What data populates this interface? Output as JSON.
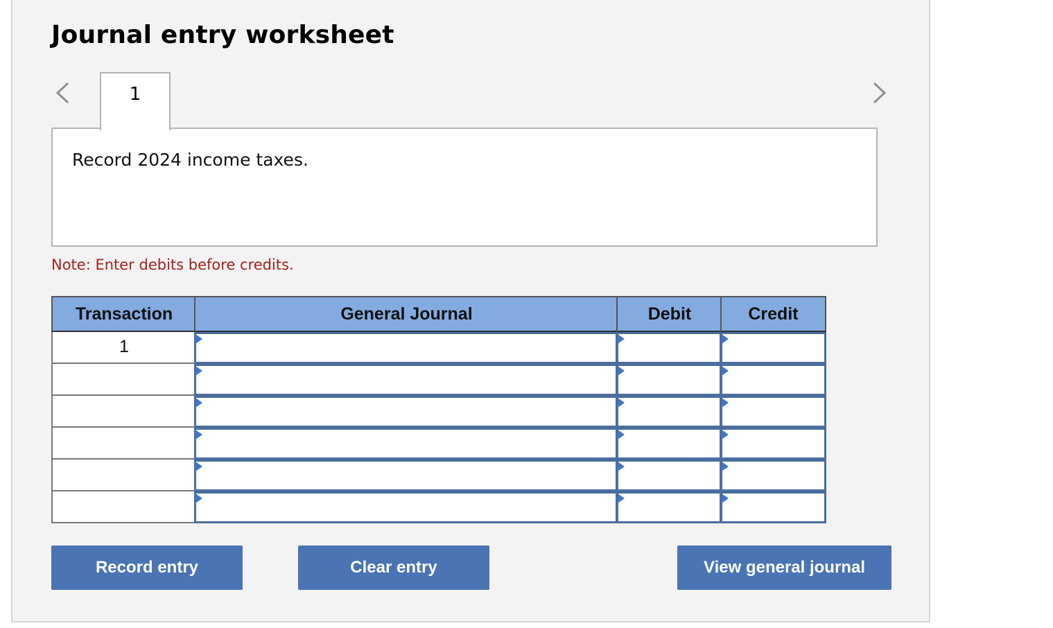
{
  "worksheet": {
    "title": "Journal entry worksheet",
    "tabs": [
      {
        "label": "1"
      }
    ],
    "description": "Record 2024 income taxes.",
    "note": "Note: Enter debits before credits."
  },
  "nav": {
    "prev_icon": "chevron-left-icon",
    "next_icon": "chevron-right-icon"
  },
  "table": {
    "headers": {
      "transaction": "Transaction",
      "general_journal": "General Journal",
      "debit": "Debit",
      "credit": "Credit"
    },
    "rows": [
      {
        "transaction": "1",
        "account": "",
        "debit": "",
        "credit": ""
      },
      {
        "transaction": "",
        "account": "",
        "debit": "",
        "credit": ""
      },
      {
        "transaction": "",
        "account": "",
        "debit": "",
        "credit": ""
      },
      {
        "transaction": "",
        "account": "",
        "debit": "",
        "credit": ""
      },
      {
        "transaction": "",
        "account": "",
        "debit": "",
        "credit": ""
      },
      {
        "transaction": "",
        "account": "",
        "debit": "",
        "credit": ""
      }
    ]
  },
  "buttons": {
    "record": "Record entry",
    "clear": "Clear entry",
    "view": "View general journal"
  },
  "colors": {
    "header_bg": "#83abe0",
    "button_bg": "#4a74b4",
    "note_text": "#a5211b",
    "input_border": "#4a6e9e"
  }
}
